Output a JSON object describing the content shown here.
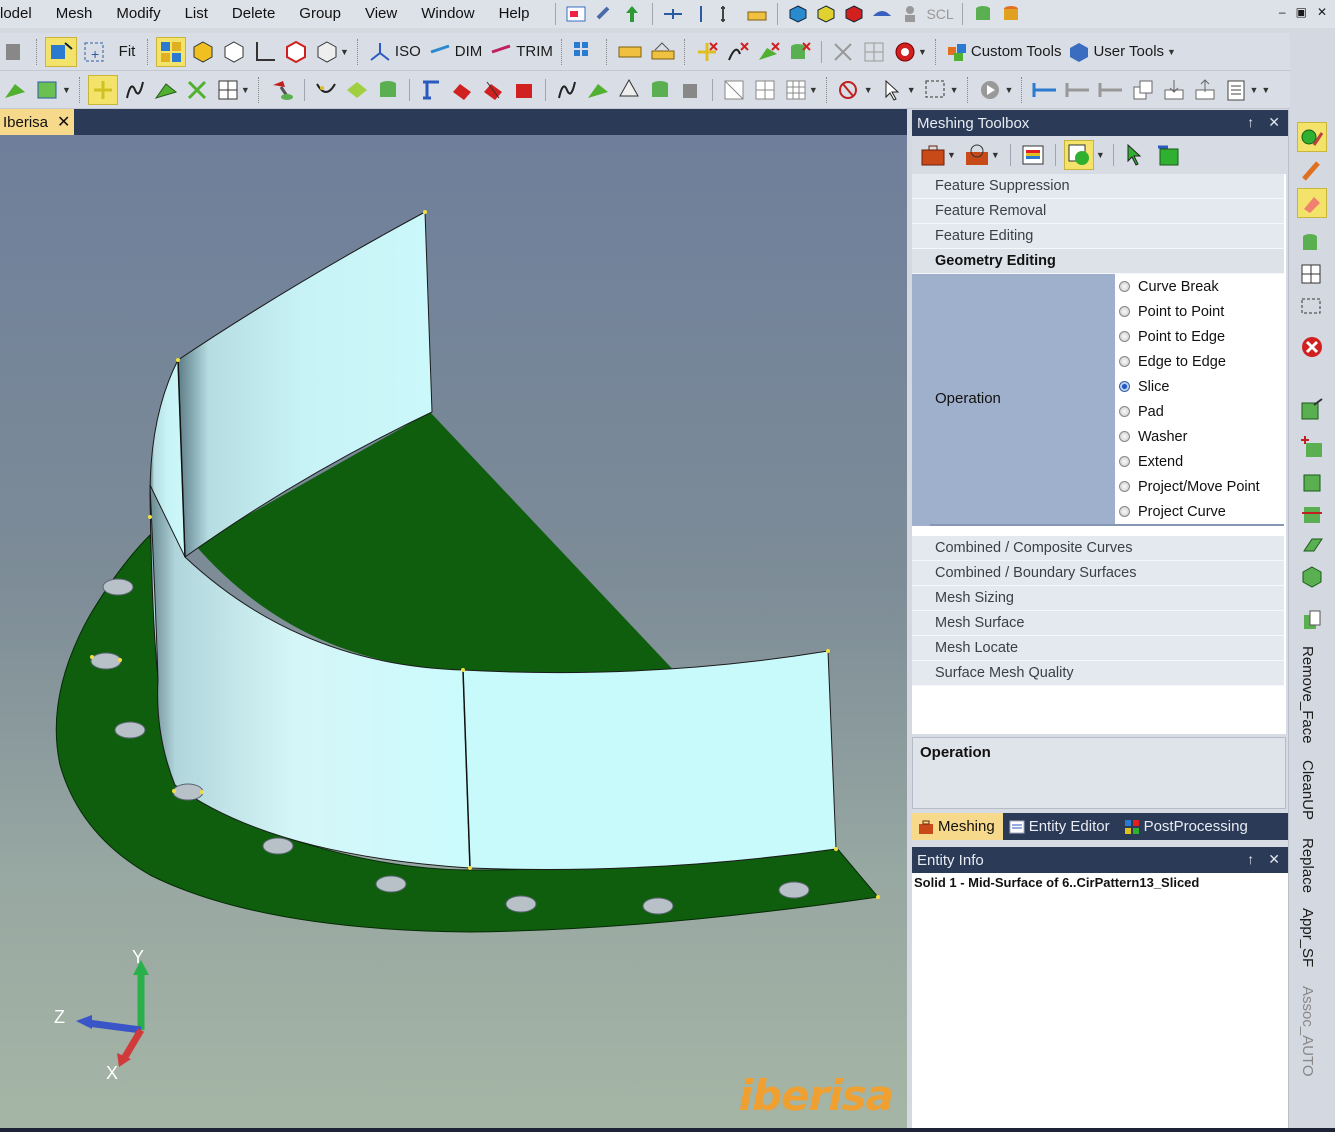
{
  "menubar": {
    "items": [
      "lodel",
      "Mesh",
      "Modify",
      "List",
      "Delete",
      "Group",
      "View",
      "Window",
      "Help"
    ],
    "scl_label": "SCL",
    "min_glyph": "–",
    "restore_glyph": "▣",
    "close_glyph": "✕"
  },
  "toolbar1": {
    "fit_label": "Fit",
    "iso_label": "ISO",
    "dim_label": "DIM",
    "trim_label": "TRIM",
    "custom_tools_label": "Custom Tools",
    "user_tools_label": "User Tools"
  },
  "doc_tab": {
    "label": "Iberisa",
    "close": "✕"
  },
  "viewport": {
    "axis_x": "X",
    "axis_y": "Y",
    "axis_z": "Z",
    "logo": "iberisa"
  },
  "meshing_toolbox": {
    "title": "Meshing Toolbox",
    "pin": "↑",
    "close": "✕",
    "sections_top": [
      "Feature Suppression",
      "Feature Removal",
      "Feature Editing"
    ],
    "geometry_editing": {
      "title": "Geometry Editing",
      "operation_label": "Operation",
      "options": [
        {
          "label": "Curve Break",
          "selected": false
        },
        {
          "label": "Point to Point",
          "selected": false
        },
        {
          "label": "Point to Edge",
          "selected": false
        },
        {
          "label": "Edge to Edge",
          "selected": false
        },
        {
          "label": "Slice",
          "selected": true
        },
        {
          "label": "Pad",
          "selected": false
        },
        {
          "label": "Washer",
          "selected": false
        },
        {
          "label": "Extend",
          "selected": false
        },
        {
          "label": "Project/Move Point",
          "selected": false
        },
        {
          "label": "Project Curve",
          "selected": false
        }
      ]
    },
    "sections_bottom": [
      "Combined / Composite Curves",
      "Combined / Boundary Surfaces",
      "Mesh Sizing",
      "Mesh Surface",
      "Mesh Locate",
      "Surface Mesh Quality"
    ],
    "operation_box_title": "Operation"
  },
  "panel_tabs": [
    "Meshing",
    "Entity Editor",
    "PostProcessing"
  ],
  "entity_info": {
    "title": "Entity Info",
    "pin": "↑",
    "close": "✕",
    "text": "Solid 1 - Mid-Surface of 6..CirPattern13_Sliced"
  },
  "right_sidebar": {
    "labels": [
      "Remove_Face",
      "CleanUP",
      "Replace",
      "Appr_SF",
      "Assoc_AUTO"
    ]
  },
  "colors": {
    "panel_header": "#2b3a57",
    "active_tab": "#f6d98a",
    "flange": "#0e5e0e",
    "wall": "#c8f6f8",
    "logo": "#f0a030"
  }
}
